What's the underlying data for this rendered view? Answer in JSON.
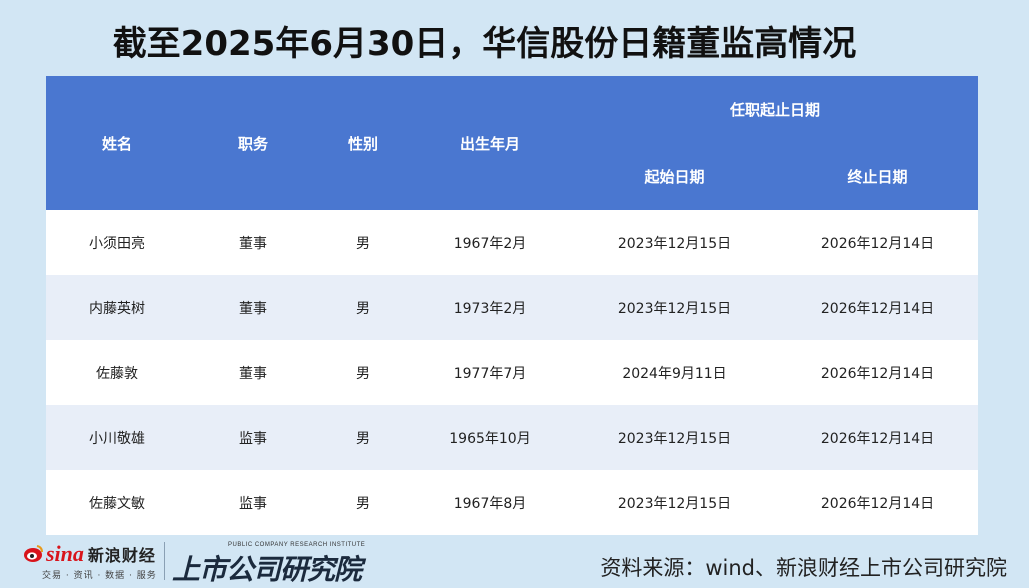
{
  "title": "截至2025年6月30日，华信股份日籍董监高情况",
  "table": {
    "headers": {
      "name": "姓名",
      "position": "职务",
      "gender": "性别",
      "birth": "出生年月",
      "tenure_group": "任职起止日期",
      "start": "起始日期",
      "end": "终止日期"
    },
    "rows": [
      {
        "name": "小须田亮",
        "position": "董事",
        "gender": "男",
        "birth": "1967年2月",
        "start": "2023年12月15日",
        "end": "2026年12月14日"
      },
      {
        "name": "内藤英树",
        "position": "董事",
        "gender": "男",
        "birth": "1973年2月",
        "start": "2023年12月15日",
        "end": "2026年12月14日"
      },
      {
        "name": "佐藤敦",
        "position": "董事",
        "gender": "男",
        "birth": "1977年7月",
        "start": "2024年9月11日",
        "end": "2026年12月14日"
      },
      {
        "name": "小川敬雄",
        "position": "监事",
        "gender": "男",
        "birth": "1965年10月",
        "start": "2023年12月15日",
        "end": "2026年12月14日"
      },
      {
        "name": "佐藤文敏",
        "position": "监事",
        "gender": "男",
        "birth": "1967年8月",
        "start": "2023年12月15日",
        "end": "2026年12月14日"
      }
    ]
  },
  "footer": {
    "sina_logo_word": "sina",
    "sina_logo_cn": "新浪财经",
    "sina_logo_sub": "交易 · 资讯 · 数据 · 服务",
    "research_logo_en": "PUBLIC COMPANY RESEARCH INSTITUTE",
    "research_logo_cn": "上市公司研究院",
    "source": "资料来源：wind、新浪财经上市公司研究院"
  },
  "colors": {
    "background": "#d2e6f4",
    "header": "#4a77d0",
    "row_alt": "#e8eef8",
    "sina_red": "#d8141b"
  }
}
